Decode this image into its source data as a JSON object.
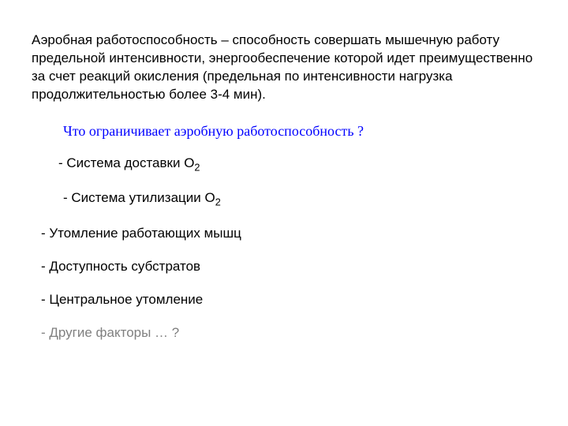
{
  "intro": "Аэробная работоспособность – способность совершать мышечную работу предельной интенсивности, энергообеспечение которой идет преимущественно за счет реакций окисления (предельная по интенсивности нагрузка продолжительностью более 3-4 мин).",
  "question": "Что ограничивает аэробную работоспособность ?",
  "items": {
    "i0_pre": "- Система доставки ",
    "i0_chem": "O",
    "i0_sub": "2",
    "i1_pre": "- Система утилизации ",
    "i1_chem": "O",
    "i1_sub": "2",
    "i2": "- Утомление работающих мышц",
    "i3": "- Доступность субстратов",
    "i4": "- Центральное утомление",
    "i5": "- Другие факторы … ?"
  }
}
